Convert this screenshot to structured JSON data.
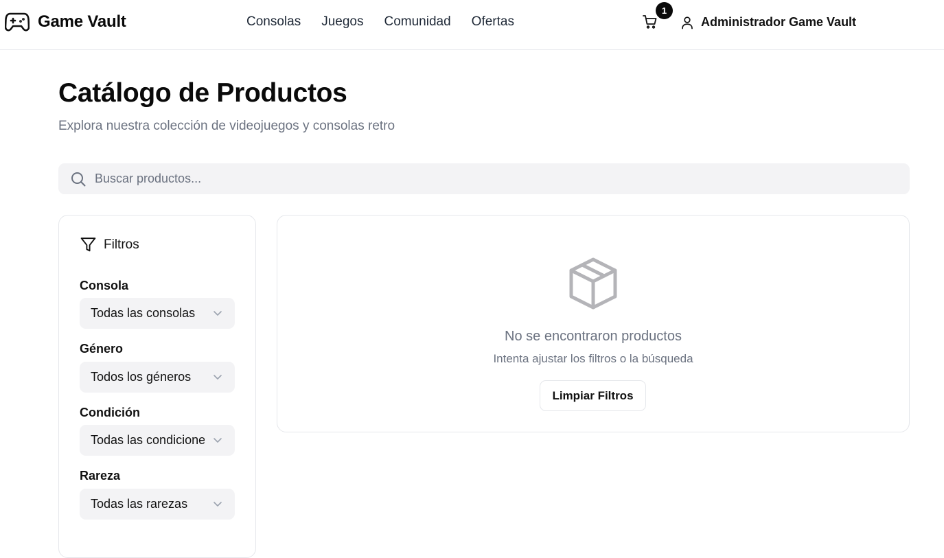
{
  "header": {
    "brand": "Game Vault",
    "nav": [
      "Consolas",
      "Juegos",
      "Comunidad",
      "Ofertas"
    ],
    "cart_count": "1",
    "user_name": "Administrador Game Vault"
  },
  "page": {
    "title": "Catálogo de Productos",
    "subtitle": "Explora nuestra colección de videojuegos y consolas retro"
  },
  "search": {
    "placeholder": "Buscar productos...",
    "value": ""
  },
  "filters": {
    "title": "Filtros",
    "groups": [
      {
        "label": "Consola",
        "selected": "Todas las consolas"
      },
      {
        "label": "Género",
        "selected": "Todos los géneros"
      },
      {
        "label": "Condición",
        "selected": "Todas las condiciones"
      },
      {
        "label": "Rareza",
        "selected": "Todas las rarezas"
      }
    ]
  },
  "results": {
    "empty_title": "No se encontraron productos",
    "empty_hint": "Intenta ajustar los filtros o la búsqueda",
    "clear_button": "Limpiar Filtros"
  },
  "icons": {
    "brand": "gamepad-icon",
    "cart": "cart-icon",
    "user": "user-icon",
    "search": "search-icon",
    "filter": "filter-icon",
    "select": "chevron-down-icon",
    "empty": "package-icon"
  },
  "colors": {
    "accent": "#0a0a0a",
    "muted_text": "#6b7280",
    "input_bg": "#f3f3f5",
    "border": "#e5e7eb"
  }
}
